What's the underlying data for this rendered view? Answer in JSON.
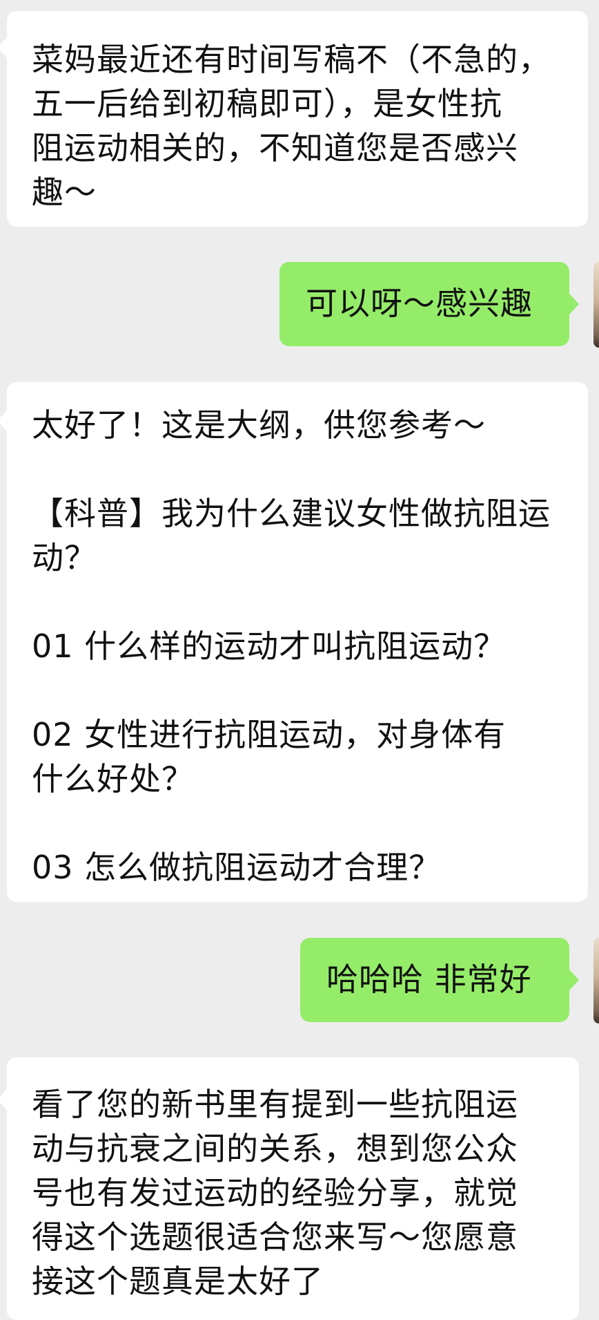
{
  "chat": {
    "messages": [
      {
        "sender": "other",
        "lines": [
          "菜妈最近还有时间写稿不（不急的，",
          "五一后给到初稿即可），是女性抗",
          "阻运动相关的，不知道您是否感兴",
          "趣～"
        ]
      },
      {
        "sender": "me",
        "lines": [
          "可以呀～感兴趣"
        ]
      },
      {
        "sender": "other",
        "lines": [
          "太好了！这是大纲，供您参考～",
          "",
          "【科普】我为什么建议女性做抗阻运",
          "动？",
          "",
          "01 什么样的运动才叫抗阻运动？",
          "",
          "02 女性进行抗阻运动，对身体有",
          "什么好处？",
          "",
          "03 怎么做抗阻运动才合理？"
        ]
      },
      {
        "sender": "me",
        "lines": [
          "哈哈哈 非常好"
        ]
      },
      {
        "sender": "other",
        "lines": [
          "看了您的新书里有提到一些抗阻运",
          "动与抗衰之间的关系，想到您公众",
          "号也有发过运动的经验分享，就觉",
          "得这个选题很适合您来写～您愿意",
          "接这个题真是太好了"
        ]
      }
    ]
  },
  "colors": {
    "background": "#ededed",
    "incoming_bubble": "#ffffff",
    "outgoing_bubble": "#95ec69",
    "text": "#111111"
  }
}
